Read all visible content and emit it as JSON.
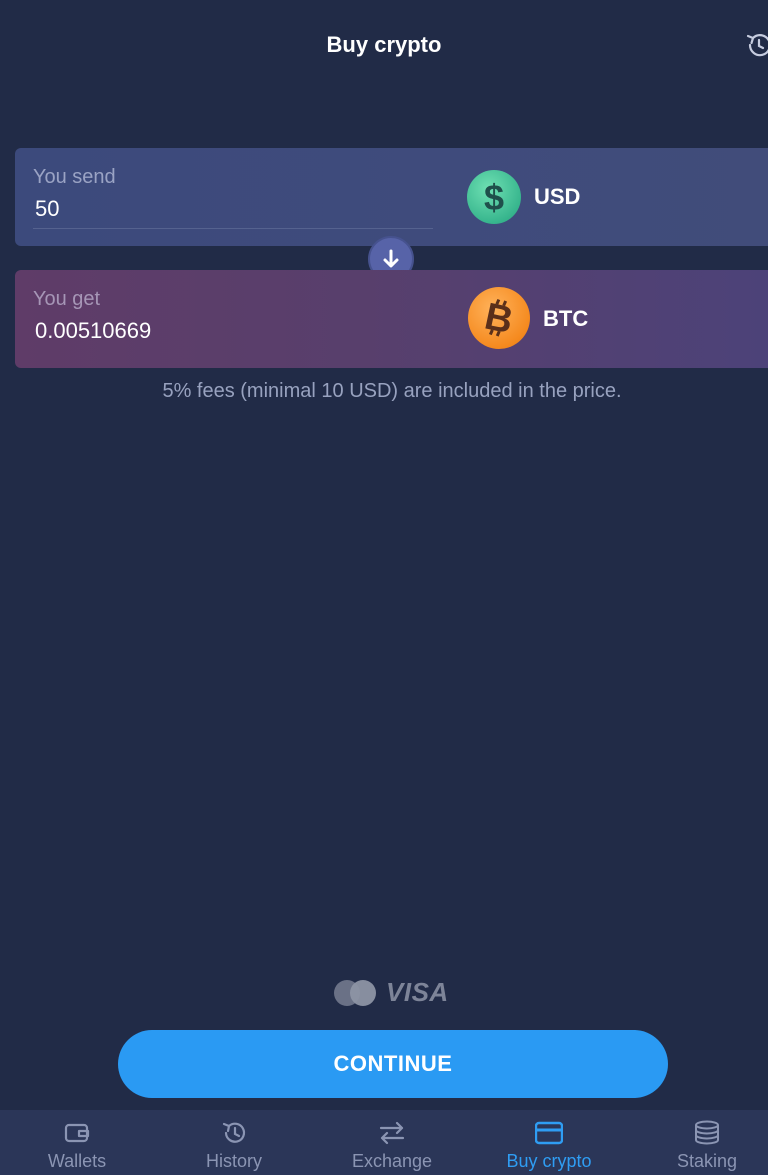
{
  "header": {
    "title": "Buy crypto",
    "history_icon": "history-icon"
  },
  "send": {
    "label": "You send",
    "value": "50",
    "currency": "USD",
    "icon": "dollar-coin-icon",
    "icon_color": "#38b68e"
  },
  "swap_icon": "arrow-down-icon",
  "get": {
    "label": "You get",
    "value": "0.00510669",
    "currency": "BTC",
    "icon": "bitcoin-coin-icon",
    "icon_color": "#f58a1f"
  },
  "fee_note": "5% fees (minimal 10 USD) are included in the price.",
  "payment": {
    "mastercard_icon": "mastercard-icon",
    "visa_label": "VISA"
  },
  "continue_label": "CONTINUE",
  "nav": {
    "items": [
      {
        "label": "Wallets",
        "icon": "wallet-icon",
        "active": false
      },
      {
        "label": "History",
        "icon": "history-icon",
        "active": false
      },
      {
        "label": "Exchange",
        "icon": "exchange-arrows-icon",
        "active": false
      },
      {
        "label": "Buy crypto",
        "icon": "credit-card-icon",
        "active": true
      },
      {
        "label": "Staking",
        "icon": "coin-stack-icon",
        "active": false
      }
    ]
  },
  "colors": {
    "background": "#212b47",
    "accent": "#2a9af3",
    "active_nav": "#2f9df3",
    "nav_bar": "#2b3658"
  }
}
